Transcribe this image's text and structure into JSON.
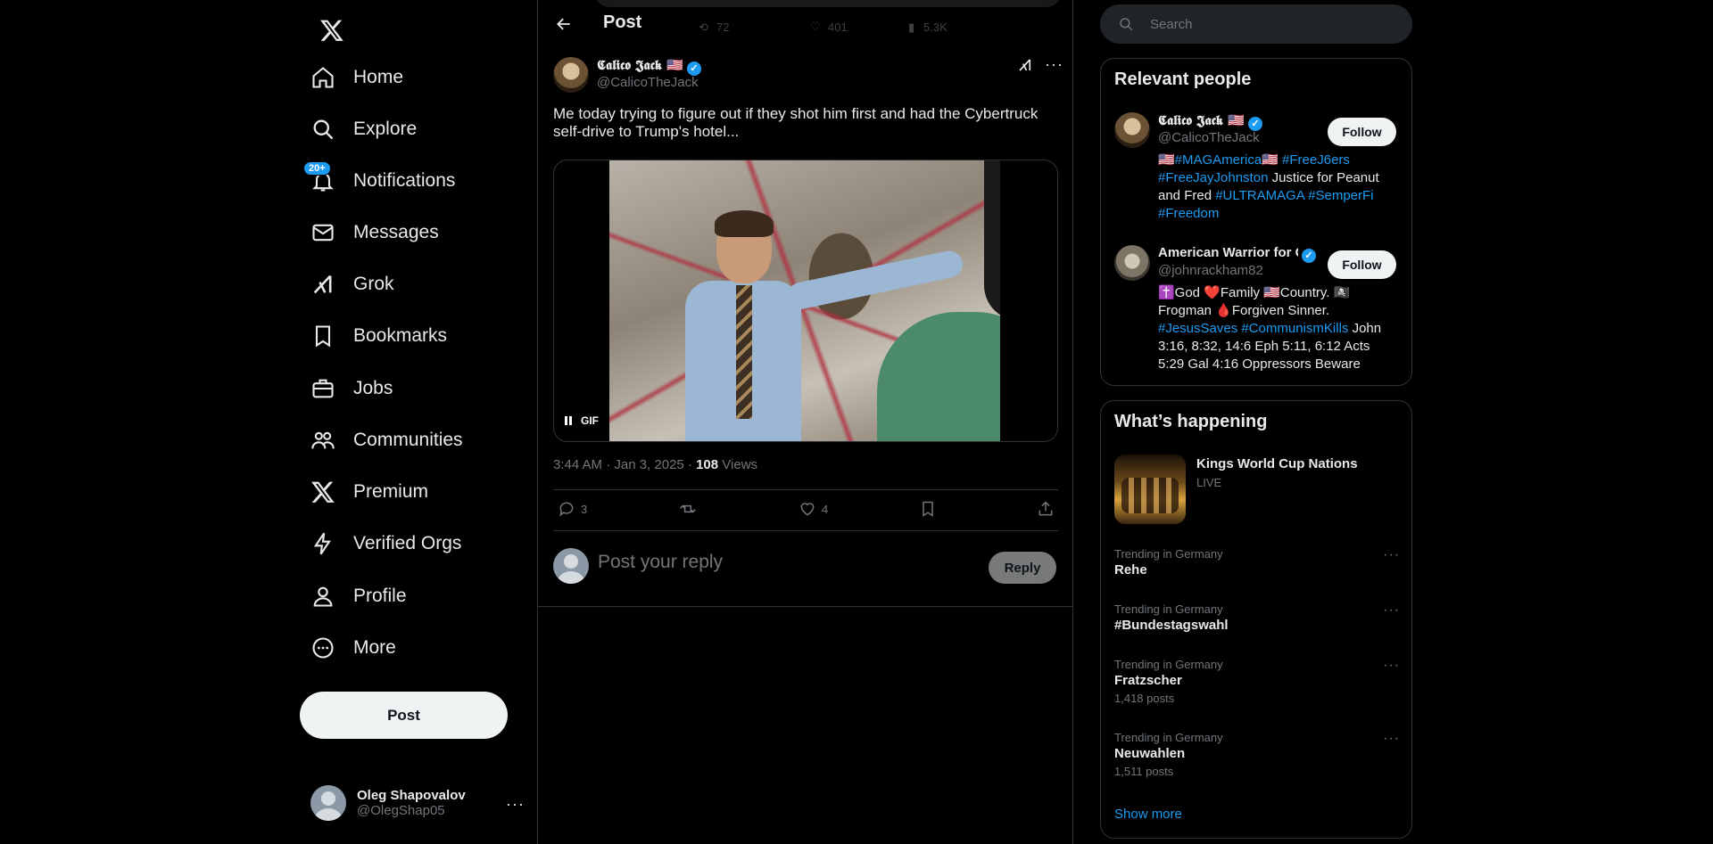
{
  "nav": {
    "items": [
      {
        "label": "Home",
        "icon": "home-icon"
      },
      {
        "label": "Explore",
        "icon": "search-icon"
      },
      {
        "label": "Notifications",
        "icon": "bell-icon",
        "badge": "20+"
      },
      {
        "label": "Messages",
        "icon": "envelope-icon"
      },
      {
        "label": "Grok",
        "icon": "grok-icon"
      },
      {
        "label": "Bookmarks",
        "icon": "bookmark-icon"
      },
      {
        "label": "Jobs",
        "icon": "briefcase-icon"
      },
      {
        "label": "Communities",
        "icon": "people-icon"
      },
      {
        "label": "Premium",
        "icon": "x-logo-icon"
      },
      {
        "label": "Verified Orgs",
        "icon": "lightning-icon"
      },
      {
        "label": "Profile",
        "icon": "person-icon"
      },
      {
        "label": "More",
        "icon": "more-circle-icon"
      }
    ],
    "post_button": "Post",
    "account": {
      "name": "Oleg Shapovalov",
      "handle": "@OlegShap05"
    }
  },
  "header": {
    "title": "Post",
    "prev_stats": {
      "retweets": "72",
      "likes": "401",
      "views": "5.3K"
    }
  },
  "tweet": {
    "author_name": "𝕮𝖆𝖑𝖎𝖈𝖔 𝕵𝖆𝖈𝖐 🇺🇸",
    "author_handle": "@CalicoTheJack",
    "text": "Me today trying to figure out if they shot him first and had the Cybertruck self-drive to Trump's hotel...",
    "media_label": "GIF",
    "timestamp": "3:44 AM · Jan 3, 2025 · ",
    "views_count": "108",
    "views_label": " Views",
    "replies": "3",
    "retweets": "",
    "likes": "4"
  },
  "reply": {
    "placeholder": "Post your reply",
    "button": "Reply"
  },
  "search": {
    "placeholder": "Search"
  },
  "relevant_people": {
    "title": "Relevant people",
    "people": [
      {
        "name": "𝕮𝖆𝖑𝖎𝖈𝖔 𝕵𝖆𝖈𝖐 🇺🇸",
        "handle": "@CalicoTheJack",
        "follow": "Follow",
        "bio_parts": [
          {
            "t": "🇺🇸#MAGAmerica🇺🇸 #FreeJ6ers #FreeJayJohnston",
            "tag": true
          },
          {
            "t": " Justice for Peanut and Fred ",
            "tag": false
          },
          {
            "t": "#ULTRAMAGA #SemperFi #Freedom",
            "tag": true
          }
        ]
      },
      {
        "name": "American Warrior for God",
        "handle": "@johnrackham82",
        "follow": "Follow",
        "bio_parts": [
          {
            "t": "✝️God ❤️Family 🇺🇸Country. 🏴‍☠️ Frogman 🩸Forgiven Sinner. ",
            "tag": false
          },
          {
            "t": "#JesusSaves #CommunismKills",
            "tag": true
          },
          {
            "t": " John 3:16, 8:32, 14:6 Eph 5:11, 6:12 Acts 5:29 Gal 4:16 Oppressors Beware",
            "tag": false
          }
        ]
      }
    ]
  },
  "whats_happening": {
    "title": "What’s happening",
    "event": {
      "title": "Kings World Cup Nations",
      "status": "LIVE"
    },
    "trends": [
      {
        "category": "Trending in Germany",
        "name": "Rehe",
        "posts": ""
      },
      {
        "category": "Trending in Germany",
        "name": "#Bundestagswahl",
        "posts": ""
      },
      {
        "category": "Trending in Germany",
        "name": "Fratzscher",
        "posts": "1,418 posts"
      },
      {
        "category": "Trending in Germany",
        "name": "Neuwahlen",
        "posts": "1,511 posts"
      }
    ],
    "show_more": "Show more"
  }
}
